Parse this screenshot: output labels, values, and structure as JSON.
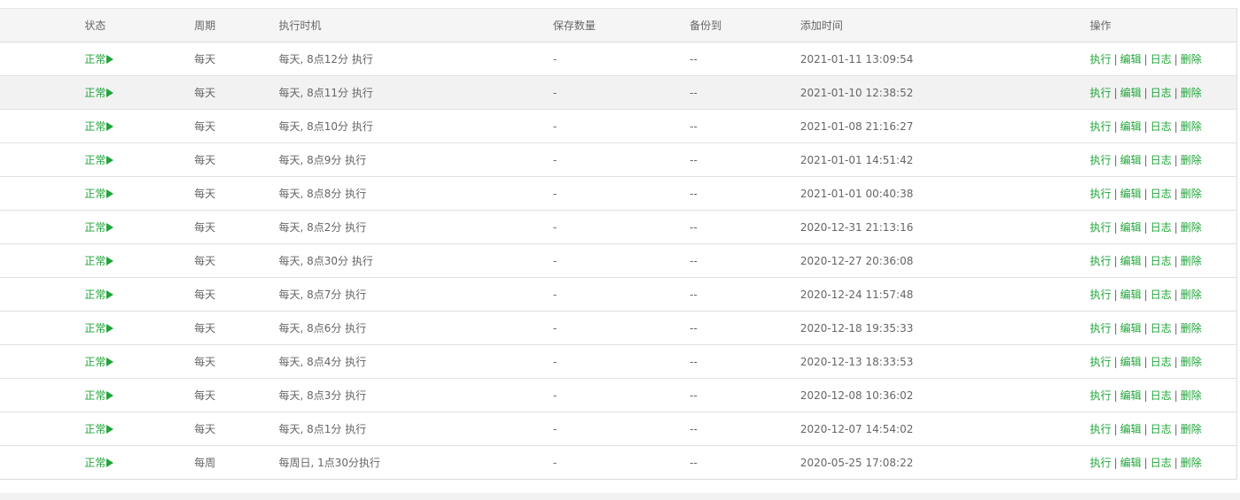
{
  "table": {
    "headers": [
      "状态",
      "周期",
      "执行时机",
      "保存数量",
      "备份到",
      "添加时间",
      "操作"
    ],
    "actions": {
      "run": "执行",
      "edit": "编辑",
      "log": "日志",
      "delete": "删除",
      "separator": "|"
    },
    "rows": [
      {
        "status": "正常",
        "cycle": "每天",
        "timing": "每天, 8点12分 执行",
        "save_count": "-",
        "backup_to": "--",
        "added": "2021-01-11 13:09:54"
      },
      {
        "status": "正常",
        "cycle": "每天",
        "timing": "每天, 8点11分 执行",
        "save_count": "-",
        "backup_to": "--",
        "added": "2021-01-10 12:38:52"
      },
      {
        "status": "正常",
        "cycle": "每天",
        "timing": "每天, 8点10分 执行",
        "save_count": "-",
        "backup_to": "--",
        "added": "2021-01-08 21:16:27"
      },
      {
        "status": "正常",
        "cycle": "每天",
        "timing": "每天, 8点9分 执行",
        "save_count": "-",
        "backup_to": "--",
        "added": "2021-01-01 14:51:42"
      },
      {
        "status": "正常",
        "cycle": "每天",
        "timing": "每天, 8点8分 执行",
        "save_count": "-",
        "backup_to": "--",
        "added": "2021-01-01 00:40:38"
      },
      {
        "status": "正常",
        "cycle": "每天",
        "timing": "每天, 8点2分 执行",
        "save_count": "-",
        "backup_to": "--",
        "added": "2020-12-31 21:13:16"
      },
      {
        "status": "正常",
        "cycle": "每天",
        "timing": "每天, 8点30分 执行",
        "save_count": "-",
        "backup_to": "--",
        "added": "2020-12-27 20:36:08"
      },
      {
        "status": "正常",
        "cycle": "每天",
        "timing": "每天, 8点7分 执行",
        "save_count": "-",
        "backup_to": "--",
        "added": "2020-12-24 11:57:48"
      },
      {
        "status": "正常",
        "cycle": "每天",
        "timing": "每天, 8点6分 执行",
        "save_count": "-",
        "backup_to": "--",
        "added": "2020-12-18 19:35:33"
      },
      {
        "status": "正常",
        "cycle": "每天",
        "timing": "每天, 8点4分 执行",
        "save_count": "-",
        "backup_to": "--",
        "added": "2020-12-13 18:33:53"
      },
      {
        "status": "正常",
        "cycle": "每天",
        "timing": "每天, 8点3分 执行",
        "save_count": "-",
        "backup_to": "--",
        "added": "2020-12-08 10:36:02"
      },
      {
        "status": "正常",
        "cycle": "每天",
        "timing": "每天, 8点1分 执行",
        "save_count": "-",
        "backup_to": "--",
        "added": "2020-12-07 14:54:02"
      },
      {
        "status": "正常",
        "cycle": "每周",
        "timing": "每周日, 1点30分执行",
        "save_count": "-",
        "backup_to": "--",
        "added": "2020-05-25 17:08:22"
      }
    ]
  },
  "icons": {
    "status_arrow": "play-arrow-icon"
  },
  "colors": {
    "accent_green": "#20a53a",
    "text_gray": "#666666",
    "header_bg": "#f5f5f5",
    "highlight_row_bg": "#f2f2f2"
  }
}
